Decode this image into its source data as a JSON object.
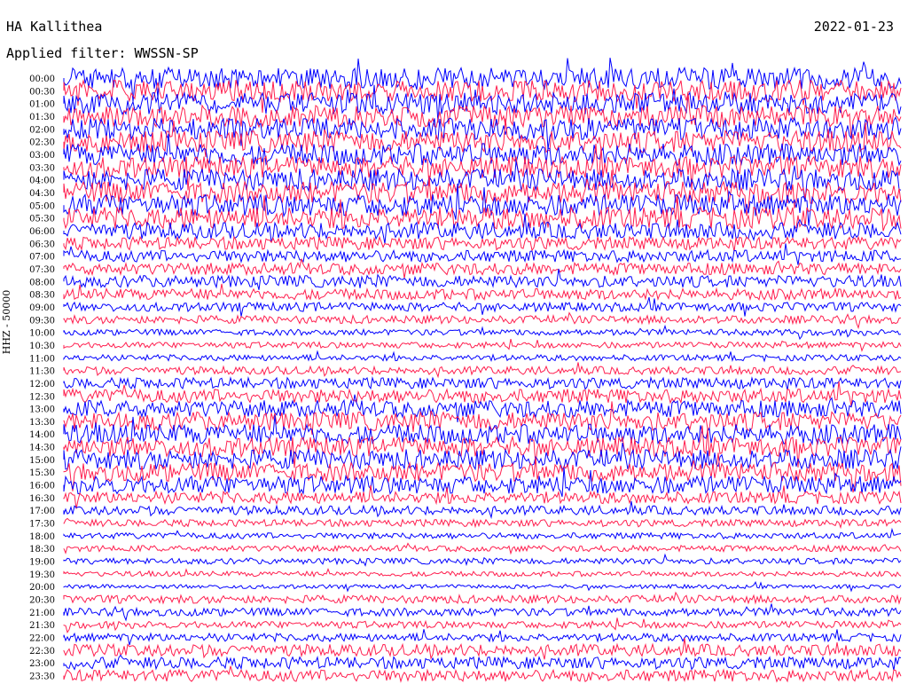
{
  "header": {
    "station": "HA Kallithea",
    "date": "2022-01-23",
    "filter": "Applied filter: WWSSN-SP"
  },
  "chart_data": {
    "type": "line",
    "title": "HA Kallithea",
    "subtitle": "Applied filter: WWSSN-SP",
    "ylabel": "HHZ - 50000",
    "series_colors": [
      "#0000ff",
      "#ff1f4f"
    ],
    "row_labels": [
      "00:00",
      "00:30",
      "01:00",
      "01:30",
      "02:00",
      "02:30",
      "03:00",
      "03:30",
      "04:00",
      "04:30",
      "05:00",
      "05:30",
      "06:00",
      "06:30",
      "07:00",
      "07:30",
      "08:00",
      "08:30",
      "09:00",
      "09:30",
      "10:00",
      "10:30",
      "11:00",
      "11:30",
      "12:00",
      "12:30",
      "13:00",
      "13:30",
      "14:00",
      "14:30",
      "15:00",
      "15:30",
      "16:00",
      "16:30",
      "17:00",
      "17:30",
      "18:00",
      "18:30",
      "19:00",
      "19:30",
      "20:00",
      "20:30",
      "21:00",
      "21:30",
      "22:00",
      "22:30",
      "23:00",
      "23:30"
    ],
    "row_noise_level": [
      1.0,
      1.0,
      1.0,
      1.0,
      1.0,
      1.0,
      1.0,
      1.0,
      1.0,
      1.0,
      1.0,
      1.0,
      0.75,
      0.55,
      0.5,
      0.5,
      0.5,
      0.45,
      0.35,
      0.3,
      0.2,
      0.2,
      0.2,
      0.3,
      0.45,
      0.6,
      0.75,
      0.85,
      0.9,
      0.9,
      0.9,
      0.85,
      0.8,
      0.5,
      0.35,
      0.25,
      0.2,
      0.2,
      0.2,
      0.15,
      0.1,
      0.3,
      0.3,
      0.25,
      0.3,
      0.5,
      0.5,
      0.5
    ]
  }
}
